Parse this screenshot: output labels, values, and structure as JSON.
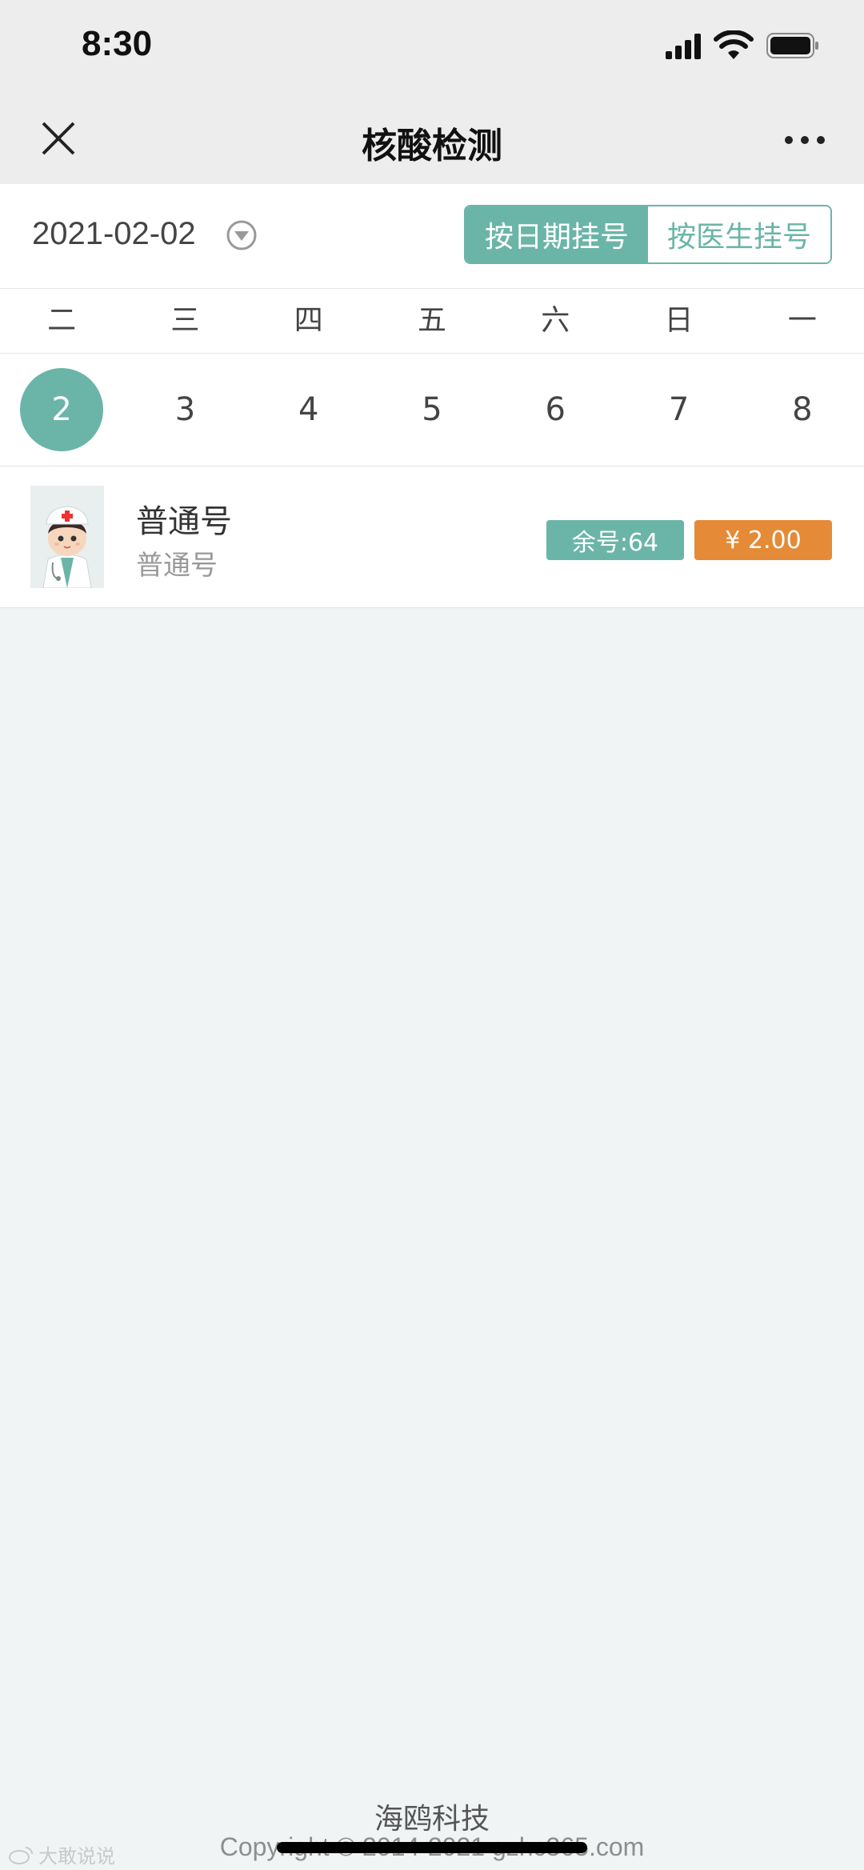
{
  "status_bar": {
    "time": "8:30"
  },
  "nav": {
    "title": "核酸检测"
  },
  "date_selector": {
    "date": "2021-02-02",
    "tabs": [
      {
        "label": "按日期挂号",
        "active": true
      },
      {
        "label": "按医生挂号",
        "active": false
      }
    ]
  },
  "week": {
    "weekdays": [
      "二",
      "三",
      "四",
      "五",
      "六",
      "日",
      "一"
    ],
    "days": [
      "2",
      "3",
      "4",
      "5",
      "6",
      "7",
      "8"
    ],
    "selected_index": 0
  },
  "schedule": [
    {
      "title": "普通号",
      "subtitle": "普通号",
      "remaining_label": "余号:64",
      "price_label": "¥ 2.00",
      "avatar_icon": "doctor-avatar"
    }
  ],
  "footer": {
    "company": "海鸥科技",
    "copyright": "Copyright © 2014-2021 gzhc365.com"
  },
  "watermark": {
    "text": "大敢说说"
  },
  "colors": {
    "accent": "#6bb5a8",
    "price": "#e58a36",
    "background": "#f0f4f5"
  }
}
